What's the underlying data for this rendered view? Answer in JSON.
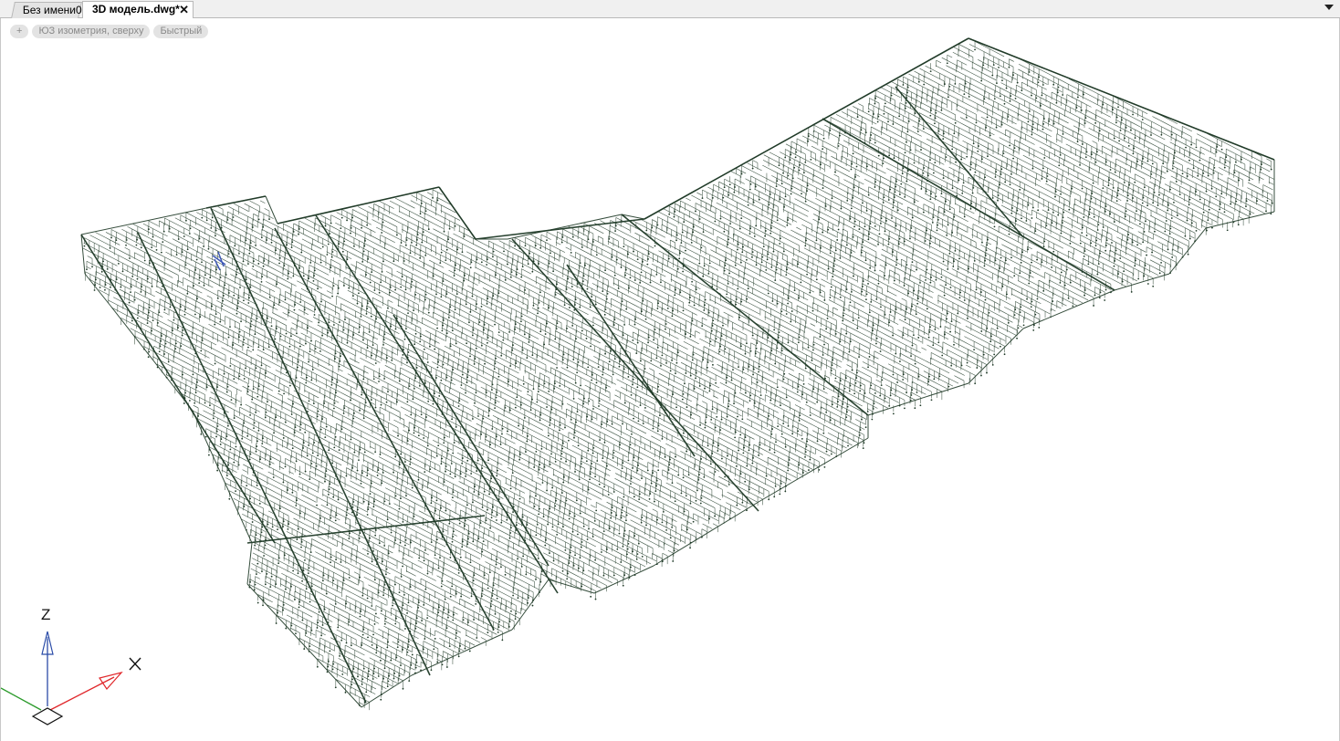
{
  "tabs": [
    {
      "label": "Без имени0",
      "active": false
    },
    {
      "label": "3D модель.dwg*",
      "active": true,
      "close": "✕"
    }
  ],
  "viewport_controls": {
    "plus": "+",
    "view": "ЮЗ изометрия, сверху",
    "style": "Быстрый"
  },
  "ucs": {
    "z_label": "Z",
    "x_label": "X",
    "colors": {
      "x": "#e0262a",
      "y": "#2a9a2a",
      "z": "#2b4ca8"
    }
  },
  "drawing": {
    "line_color": "#1f3a27",
    "view": "wireframe"
  },
  "icons": {
    "tab_close": "close-icon",
    "tab_list": "chevron-down-icon"
  }
}
